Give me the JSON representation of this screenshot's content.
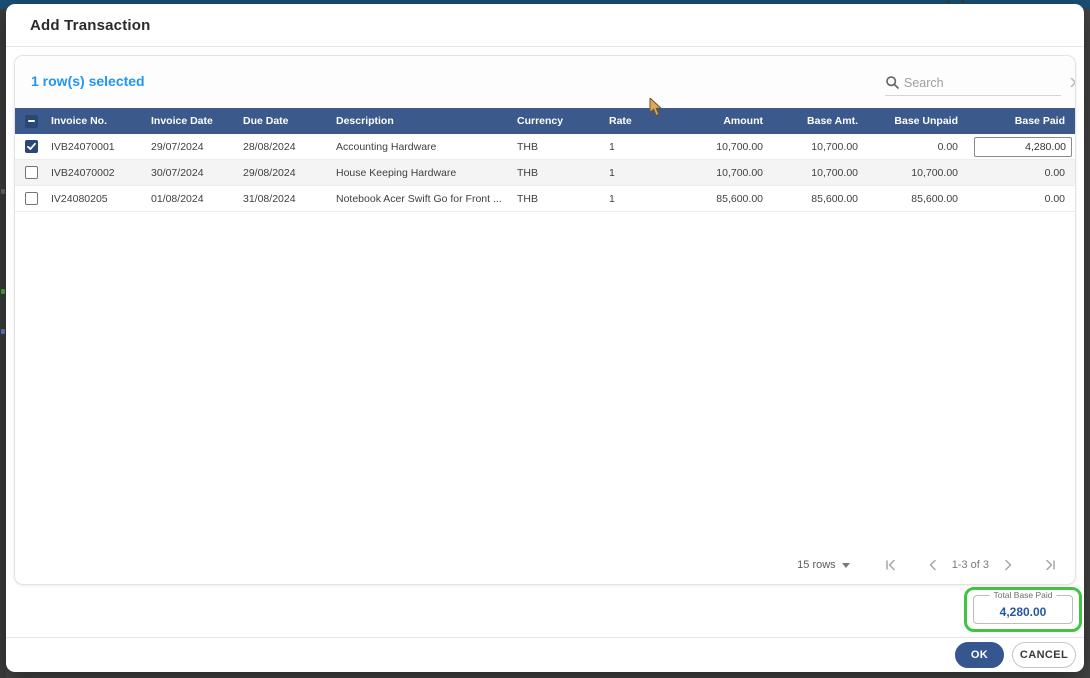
{
  "dialog": {
    "title": "Add Transaction",
    "selection_status": "1 row(s) selected",
    "search": {
      "placeholder": "Search",
      "value": ""
    },
    "table": {
      "columns": [
        {
          "label": "Invoice No."
        },
        {
          "label": "Invoice Date"
        },
        {
          "label": "Due Date"
        },
        {
          "label": "Description"
        },
        {
          "label": "Currency"
        },
        {
          "label": "Rate"
        },
        {
          "label": "Amount"
        },
        {
          "label": "Base Amt."
        },
        {
          "label": "Base Unpaid"
        },
        {
          "label": "Base Paid"
        }
      ],
      "rows": [
        {
          "checked": true,
          "invoice_no": "IVB24070001",
          "invoice_date": "29/07/2024",
          "due_date": "28/08/2024",
          "description": "Accounting Hardware",
          "currency": "THB",
          "rate": "1",
          "amount": "10,700.00",
          "base_amt": "10,700.00",
          "base_unpaid": "0.00",
          "base_paid": "4,280.00"
        },
        {
          "checked": false,
          "invoice_no": "IVB24070002",
          "invoice_date": "30/07/2024",
          "due_date": "29/08/2024",
          "description": "House Keeping Hardware",
          "currency": "THB",
          "rate": "1",
          "amount": "10,700.00",
          "base_amt": "10,700.00",
          "base_unpaid": "10,700.00",
          "base_paid": "0.00"
        },
        {
          "checked": false,
          "invoice_no": "IV24080205",
          "invoice_date": "01/08/2024",
          "due_date": "31/08/2024",
          "description": "Notebook Acer Swift Go for Front ...",
          "currency": "THB",
          "rate": "1",
          "amount": "85,600.00",
          "base_amt": "85,600.00",
          "base_unpaid": "85,600.00",
          "base_paid": "0.00"
        }
      ]
    },
    "pagination": {
      "rows_per_page": "15 rows",
      "range": "1-3 of 3"
    },
    "total_base_paid": {
      "label": "Total Base Paid",
      "value": "4,280.00"
    },
    "buttons": {
      "ok": "OK",
      "cancel": "CANCEL"
    },
    "colors": {
      "header_navy": "#3B598A",
      "checkbox_navy": "#2A4875",
      "selection_blue": "#2196F3",
      "total_value_blue": "#2456A6",
      "highlight_green": "#3FC53F",
      "ok_button_navy": "#35568E",
      "topbar_blue": "#1A5078"
    },
    "icons": [
      "search-icon",
      "clear-search-icon",
      "dropdown-caret-icon",
      "first-page-icon",
      "prev-page-icon",
      "next-page-icon",
      "last-page-icon",
      "checkbox-checked-icon",
      "checkbox-indeterminate-icon",
      "mouse-cursor-icon"
    ]
  }
}
